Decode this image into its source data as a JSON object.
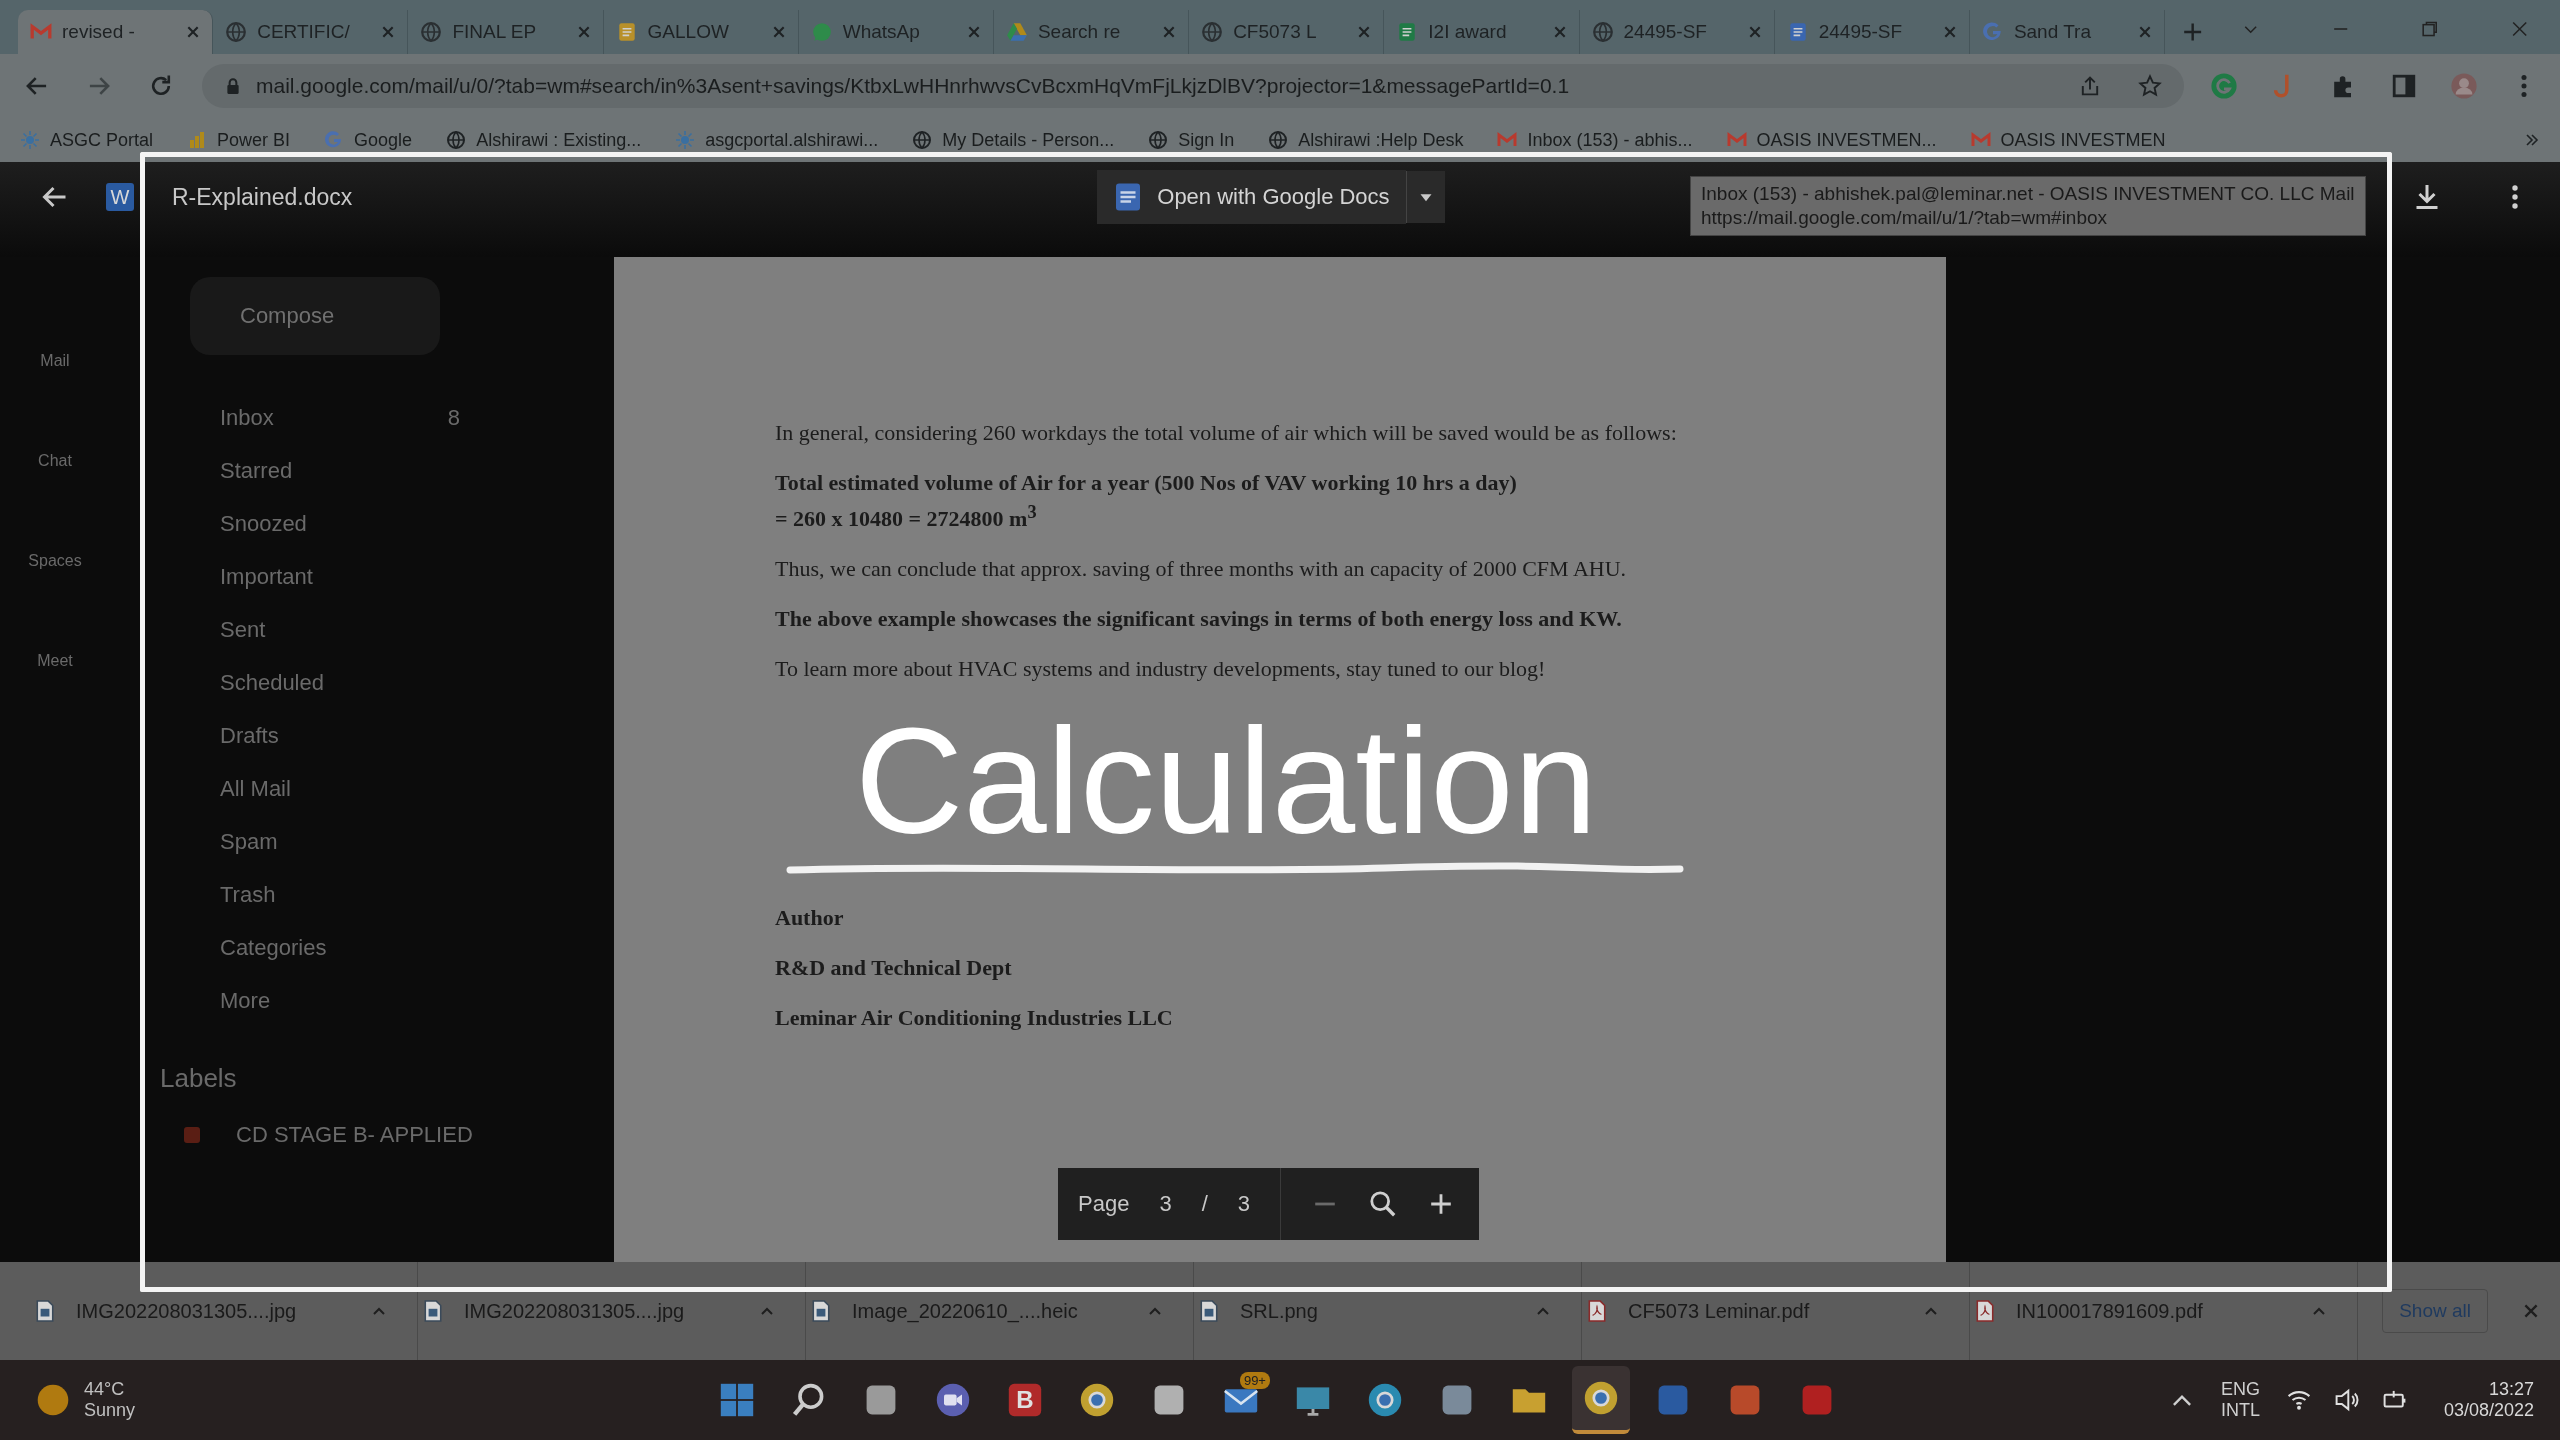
{
  "browser": {
    "tabs": [
      {
        "title": "revised -",
        "kind": "gmail",
        "selected": true
      },
      {
        "title": "CERTIFIC/",
        "kind": "globe",
        "selected": false
      },
      {
        "title": "FINAL EP",
        "kind": "globe",
        "selected": false
      },
      {
        "title": "GALLOW",
        "kind": "slides",
        "selected": false
      },
      {
        "title": "WhatsAp",
        "kind": "whatsapp",
        "selected": false
      },
      {
        "title": "Search re",
        "kind": "drive",
        "selected": false
      },
      {
        "title": "CF5073 L",
        "kind": "globe",
        "selected": false
      },
      {
        "title": "I2I award",
        "kind": "sheets",
        "selected": false
      },
      {
        "title": "24495-SF",
        "kind": "globe",
        "selected": false
      },
      {
        "title": "24495-SF",
        "kind": "docs",
        "selected": false
      },
      {
        "title": "Sand Tra",
        "kind": "google",
        "selected": false
      }
    ],
    "url": "mail.google.com/mail/u/0/?tab=wm#search/in%3Asent+savings/KtbxLwHHnrhwvsCvBcxmHqVmFjLkjzDlBV?projector=1&messagePartId=0.1",
    "bookmarks": [
      {
        "label": "ASGC Portal",
        "kind": "asgc"
      },
      {
        "label": "Power BI",
        "kind": "powerbi"
      },
      {
        "label": "Google",
        "kind": "google"
      },
      {
        "label": "Alshirawi : Existing...",
        "kind": "globe"
      },
      {
        "label": "asgcportal.alshirawi...",
        "kind": "asgc"
      },
      {
        "label": "My Details - Person...",
        "kind": "globe"
      },
      {
        "label": "Sign In",
        "kind": "globe"
      },
      {
        "label": "Alshirawi :Help Desk",
        "kind": "globe"
      },
      {
        "label": "Inbox (153) - abhis...",
        "kind": "gmail"
      },
      {
        "label": "OASIS INVESTMEN...",
        "kind": "gmail"
      },
      {
        "label": "OASIS INVESTMEN",
        "kind": "gmail"
      }
    ],
    "tooltip": [
      "Inbox (153) - abhishek.pal@leminar.net - OASIS INVESTMENT CO. LLC Mail",
      "https://mail.google.com/mail/u/1/?tab=wm#inbox"
    ]
  },
  "gmail": {
    "rail": [
      "Mail",
      "Chat",
      "Spaces",
      "Meet"
    ],
    "compose": "Compose",
    "folders": [
      {
        "label": "Inbox",
        "count": "8"
      },
      {
        "label": "Starred"
      },
      {
        "label": "Snoozed"
      },
      {
        "label": "Important"
      },
      {
        "label": "Sent"
      },
      {
        "label": "Scheduled"
      },
      {
        "label": "Drafts"
      },
      {
        "label": "All Mail"
      },
      {
        "label": "Spam"
      },
      {
        "label": "Trash"
      },
      {
        "label": "Categories"
      },
      {
        "label": "More"
      }
    ],
    "labels_heading": "Labels",
    "labels": [
      {
        "label": "CD STAGE B- APPLIED",
        "color": "#5a1e14"
      }
    ]
  },
  "viewer": {
    "file_badge": "W",
    "file_name": "R-Explained.docx",
    "open_button": "Open with Google Docs",
    "paragraphs": [
      {
        "kind": "normal",
        "lines": [
          "In general, considering 260 workdays the total volume of air which will be saved  would be as follows:"
        ]
      },
      {
        "kind": "bold",
        "lines": [
          "Total estimated volume of Air for a year (500 Nos of VAV working 10 hrs a day)",
          "= 260 x 10480 = 2724800 m$^{3}$"
        ]
      },
      {
        "kind": "normal",
        "lines": [
          "Thus, we can conclude that approx. saving of three months with an capacity of 2000 CFM AHU."
        ]
      },
      {
        "kind": "bold",
        "lines": [
          "The above example showcases the significant savings in terms of both energy loss and KW."
        ]
      },
      {
        "kind": "normal",
        "lines": [
          "To learn more about HVAC systems and industry developments, stay tuned to our blog!"
        ]
      },
      {
        "kind": "title",
        "lines": [
          "Calculation"
        ]
      },
      {
        "kind": "bold",
        "lines": [
          "Author"
        ]
      },
      {
        "kind": "bold",
        "lines": [
          "R&D and Technical Dept"
        ]
      },
      {
        "kind": "bold",
        "lines": [
          "Leminar Air Conditioning Industries LLC"
        ]
      }
    ],
    "page": {
      "label": "Page",
      "current": "3",
      "separator": "/",
      "total": "3"
    }
  },
  "downloads": {
    "items": [
      {
        "name": "IMG202208031305....jpg",
        "kind": "image"
      },
      {
        "name": "IMG202208031305....jpg",
        "kind": "image"
      },
      {
        "name": "Image_20220610_....heic",
        "kind": "image"
      },
      {
        "name": "SRL.png",
        "kind": "image"
      },
      {
        "name": "CF5073 Leminar.pdf",
        "kind": "pdf"
      },
      {
        "name": "IN100017891609.pdf",
        "kind": "pdf"
      }
    ],
    "show_all": "Show all"
  },
  "taskbar": {
    "weather": {
      "temp": "44°C",
      "condition": "Sunny"
    },
    "apps": [
      {
        "kind": "start"
      },
      {
        "kind": "search"
      },
      {
        "kind": "taskview"
      },
      {
        "kind": "chat"
      },
      {
        "kind": "letter",
        "glyph": "B"
      },
      {
        "kind": "chrome"
      },
      {
        "kind": "store"
      },
      {
        "kind": "mail",
        "badge": "99+"
      },
      {
        "kind": "monitor"
      },
      {
        "kind": "edge"
      },
      {
        "kind": "window"
      },
      {
        "kind": "folder"
      },
      {
        "kind": "chrome",
        "active": true
      },
      {
        "kind": "word"
      },
      {
        "kind": "powerpoint"
      },
      {
        "kind": "acrobat"
      }
    ],
    "language": [
      "ENG",
      "INTL"
    ],
    "time": "13:27",
    "date": "03/08/2022"
  }
}
